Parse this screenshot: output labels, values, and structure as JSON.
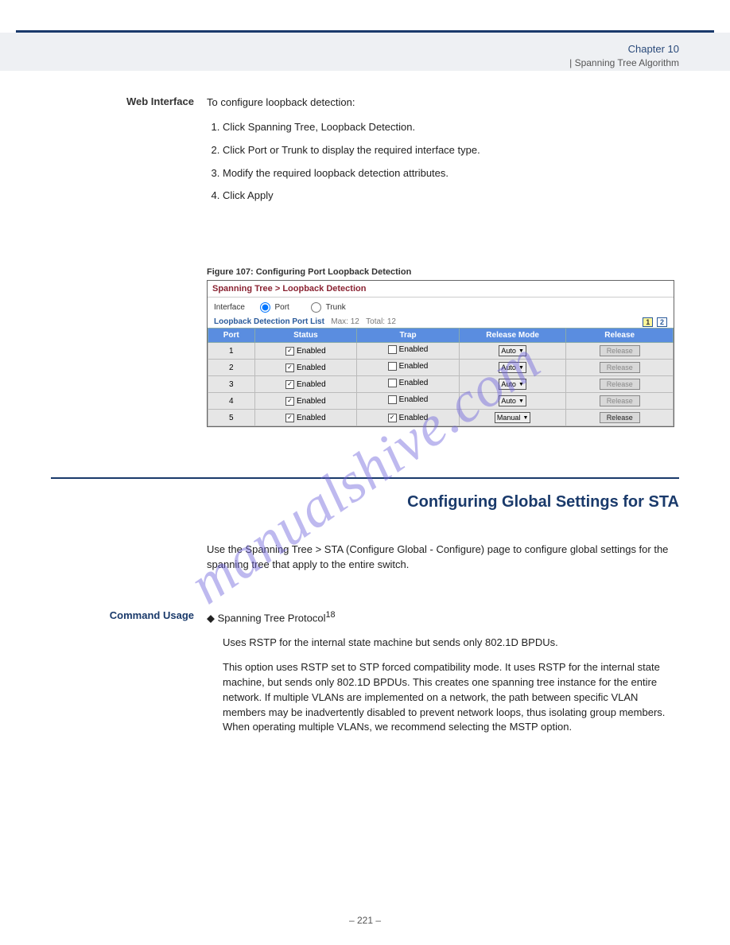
{
  "header": {
    "chapter_label": "Chapter 10",
    "chapter_title": "| Spanning Tree Algorithm"
  },
  "web_steps": {
    "intro_click": "To configure loopback detection:",
    "step1": "Click Spanning Tree, Loopback Detection.",
    "step2": "Click Port or Trunk to display the required interface type.",
    "step3": "Modify the required loopback detection attributes.",
    "step4": "Click Apply"
  },
  "figure_label": "Figure 107: Configuring Port Loopback Detection",
  "screenshot": {
    "breadcrumb": "Spanning Tree > Loopback Detection",
    "if_label": "Interface",
    "if_port": "Port",
    "if_trunk": "Trunk",
    "list_title": "Loopback Detection Port List",
    "max_label": "Max: 12",
    "total_label": "Total: 12",
    "pages": [
      "1",
      "2"
    ],
    "cols": {
      "port": "Port",
      "status": "Status",
      "trap": "Trap",
      "mode": "Release Mode",
      "release": "Release"
    },
    "enabled_text": "Enabled",
    "release_btn": "Release",
    "rows": [
      {
        "port": "1",
        "status_chk": true,
        "trap_chk": false,
        "mode": "Auto",
        "rel_en": false
      },
      {
        "port": "2",
        "status_chk": true,
        "trap_chk": false,
        "mode": "Auto",
        "rel_en": false
      },
      {
        "port": "3",
        "status_chk": true,
        "trap_chk": false,
        "mode": "Auto",
        "rel_en": false
      },
      {
        "port": "4",
        "status_chk": true,
        "trap_chk": false,
        "mode": "Auto",
        "rel_en": false
      },
      {
        "port": "5",
        "status_chk": true,
        "trap_chk": true,
        "mode": "Manual",
        "rel_en": true
      }
    ]
  },
  "section": {
    "title": "Configuring Global Settings for STA",
    "sub": "",
    "intro": "Use the Spanning Tree > STA (Configure Global - Configure) page to configure global settings for the spanning tree that apply to the entire switch.",
    "cg_label": "Command Usage",
    "cg_bullet": "Spanning Tree Protocol",
    "cg_sub1": "This option uses RSTP set to STP forced compatibility mode. It uses RSTP for the internal state machine, but sends only 802.1D BPDUs. This creates one spanning tree instance for the entire network. If multiple VLANs are implemented on a network, the path between specific VLAN members may be inadvertently disabled to prevent network loops, thus isolating group members. When operating multiple VLANs, we recommend selecting the MSTP option.",
    "cg_sub1_note": "Uses RSTP for the internal state machine but sends only 802.1D BPDUs."
  },
  "page_number": "– 221 –",
  "watermark": "manualshive.com"
}
